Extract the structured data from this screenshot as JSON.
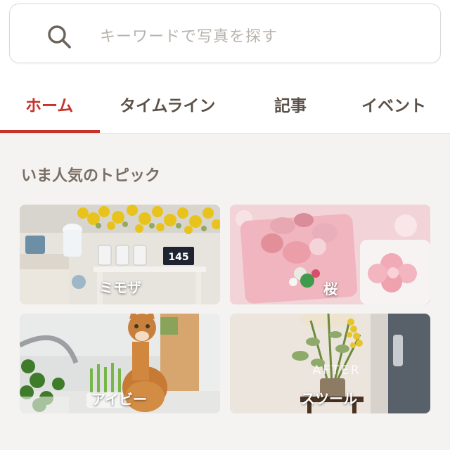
{
  "search": {
    "placeholder": "キーワードで写真を探す"
  },
  "tabs": [
    {
      "label": "ホーム",
      "active": true
    },
    {
      "label": "タイムライン",
      "active": false
    },
    {
      "label": "記事",
      "active": false
    },
    {
      "label": "イベント",
      "active": false
    }
  ],
  "section": {
    "title": "いま人気のトピック"
  },
  "topics": [
    {
      "label": "ミモザ",
      "photo_number": "145"
    },
    {
      "label": "桜"
    },
    {
      "label": "アイビー"
    },
    {
      "label": "スツール",
      "photo_text": "AFTER"
    }
  ],
  "colors": {
    "accent": "#c8312b",
    "text": "#5b5148",
    "background": "#f4f3f1"
  },
  "icons": {
    "search": "search-icon"
  }
}
